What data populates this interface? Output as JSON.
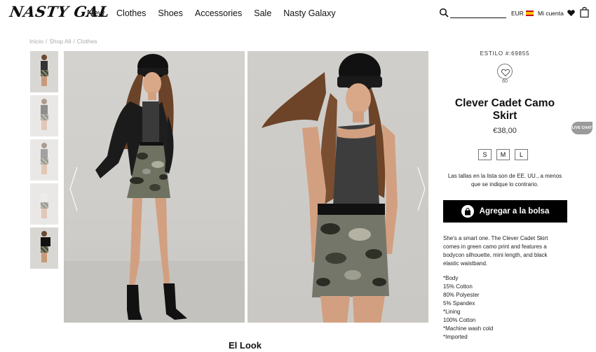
{
  "header": {
    "logo": "NASTY GAL",
    "nav": [
      "New",
      "Clothes",
      "Shoes",
      "Accessories",
      "Sale",
      "Nasty Galaxy"
    ],
    "search_placeholder": "",
    "currency": "EUR",
    "account": "Mi cuenta"
  },
  "breadcrumb": [
    "Inicio",
    "Shop All",
    "Clothes"
  ],
  "product": {
    "style": "ESTILO #:69855",
    "favorites_count": "60",
    "title": "Clever Cadet Camo Skirt",
    "price": "€38,00",
    "sizes": [
      "S",
      "M",
      "L"
    ],
    "size_note": "Las tallas en la lista son de EE. UU., a menos que se indique lo contrario.",
    "add_to_bag": "Agregar a la bolsa",
    "description": "She's a smart one. The Clever Cadet Skirt comes in green camo print and features a bodycon silhouette, mini length, and black elastic waistband.",
    "specs": [
      "*Body",
      "15% Cotton",
      "80% Polyester",
      "5% Spandex",
      "*Lining",
      "100% Cotton",
      "*Machine wash cold",
      "*Imported"
    ]
  },
  "section_title": "El Look",
  "live_chat": "LIVE CHAT",
  "colors": {
    "accent": "#000000",
    "background": "#ffffff",
    "muted": "#aaaaaa"
  }
}
